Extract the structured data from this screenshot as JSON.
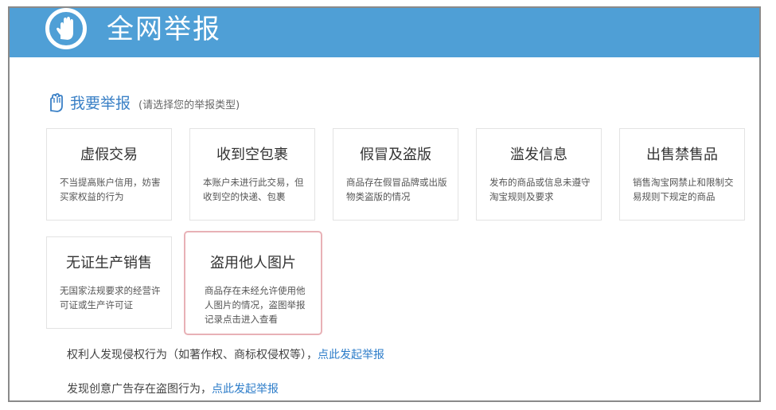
{
  "header": {
    "title": "全网举报",
    "logo_icon": "hand-icon",
    "bg_color": "#4f9fd6"
  },
  "section": {
    "heading": "我要举报",
    "hint": "(请选择您的举报类型)",
    "icon": "hand-outline-icon"
  },
  "categories": [
    {
      "title": "虚假交易",
      "desc": "不当提高账户信用，妨害买家权益的行为"
    },
    {
      "title": "收到空包裹",
      "desc": "本账户未进行此交易，但收到空的快递、包裹"
    },
    {
      "title": "假冒及盗版",
      "desc": "商品存在假冒品牌或出版物类盗版的情况"
    },
    {
      "title": "滥发信息",
      "desc": "发布的商品或信息未遵守淘宝规则及要求"
    },
    {
      "title": "出售禁售品",
      "desc": "销售淘宝网禁止和限制交易规则下规定的商品"
    },
    {
      "title": "无证生产销售",
      "desc": "无国家法规要求的经营许可证或生产许可证"
    },
    {
      "title": "盗用他人图片",
      "desc": "商品存在未经允许使用他人图片的情况，盗图举报记录点击进入查看"
    }
  ],
  "links": {
    "rights_text": "权利人发现侵权行为（如著作权、商标权侵权等），",
    "rights_link": "点此发起举报",
    "ad_text": "发现创意广告存在盗图行为，",
    "ad_link": "点此发起举报"
  },
  "colors": {
    "accent": "#3a80c6",
    "highlight_border": "#e8b1b6"
  }
}
